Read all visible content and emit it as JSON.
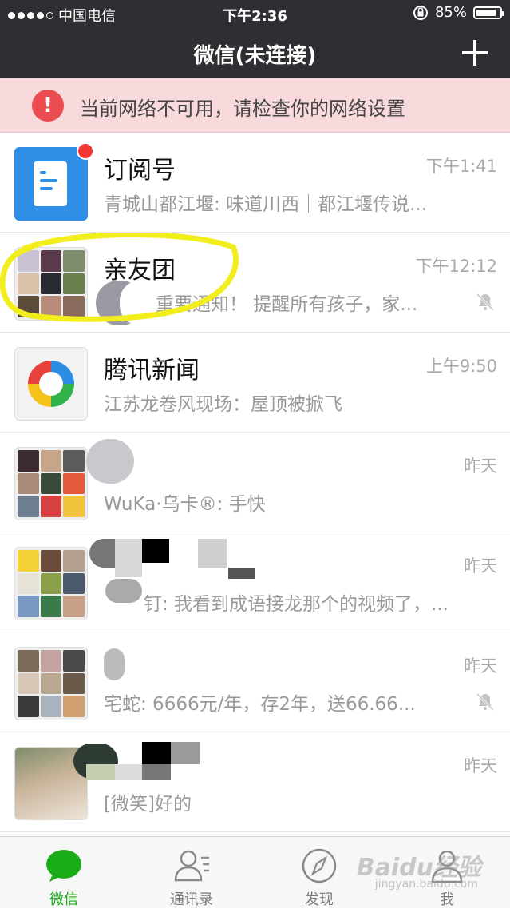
{
  "status_bar": {
    "carrier": "中国电信",
    "time": "下午2:36",
    "battery_percent": "85%",
    "battery_level": 0.85
  },
  "nav": {
    "title": "微信(未连接)",
    "plus_icon": "plus-icon"
  },
  "alert": {
    "icon": "exclamation-icon",
    "text": "当前网络不可用，请检查你的网络设置"
  },
  "chats": [
    {
      "name": "订阅号",
      "time": "下午1:41",
      "preview": "青城山都江堰: 味道川西｜都江堰传说...",
      "unread_dot": true,
      "muted": false
    },
    {
      "name": "亲友团",
      "time": "下午12:12",
      "preview": "重要通知！ 提醒所有孩子，家...",
      "unread_dot": false,
      "muted": true
    },
    {
      "name": "腾讯新闻",
      "time": "上午9:50",
      "preview": "江苏龙卷风现场：屋顶被掀飞",
      "unread_dot": false,
      "muted": false
    },
    {
      "name": "",
      "time": "昨天",
      "preview": "WuKa·乌卡®: 手快",
      "unread_dot": false,
      "muted": false
    },
    {
      "name": "",
      "time": "昨天",
      "preview": "钉: 我看到成语接龙那个的视频了，...",
      "unread_dot": false,
      "muted": false
    },
    {
      "name": "",
      "time": "昨天",
      "preview": "宅蛇: 6666元/年，存2年，送66.66...",
      "unread_dot": false,
      "muted": true
    },
    {
      "name": "",
      "time": "昨天",
      "preview": "[微笑]好的",
      "unread_dot": false,
      "muted": false
    }
  ],
  "tabs": [
    {
      "label": "微信",
      "icon": "chat-bubble-icon",
      "active": true
    },
    {
      "label": "通讯录",
      "icon": "contacts-icon",
      "active": false
    },
    {
      "label": "发现",
      "icon": "compass-icon",
      "active": false
    },
    {
      "label": "我",
      "icon": "person-icon",
      "active": false
    }
  ],
  "watermark": {
    "text": "Baidu经验",
    "sub": "jingyan.baidu.com"
  },
  "colors": {
    "accent": "#1aad19",
    "nav_bg": "#2e2e33",
    "alert_bg": "#f8d9dc",
    "alert_icon": "#ea4c4f",
    "highlight_circle": "#f2ee1d"
  }
}
